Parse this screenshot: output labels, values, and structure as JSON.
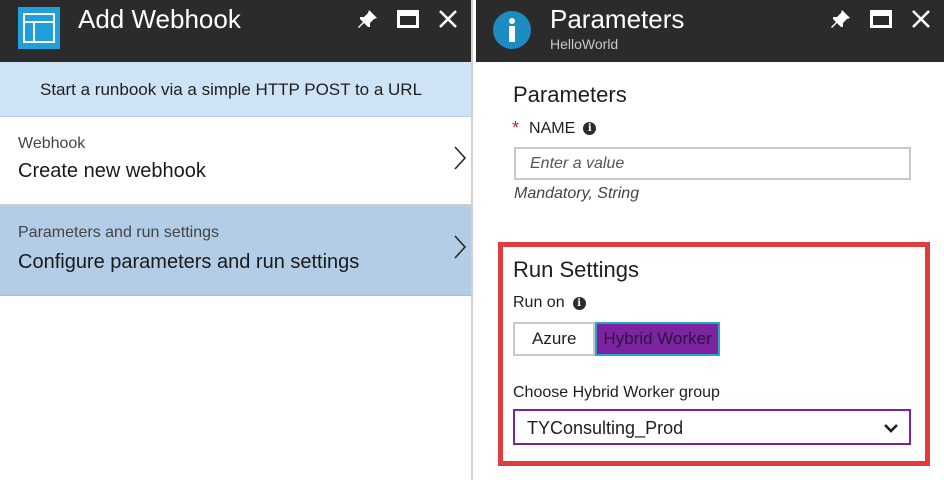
{
  "left_blade": {
    "title": "Add Webhook",
    "icon": "blade-layout-icon",
    "info_text": "Start a runbook via a simple HTTP POST to a URL",
    "items": [
      {
        "sublabel": "Webhook",
        "label": "Create new webhook"
      },
      {
        "sublabel": "Parameters and run settings",
        "label": "Configure parameters and run settings"
      }
    ]
  },
  "right_blade": {
    "title": "Parameters",
    "subtitle": "HelloWorld",
    "icon": "info-icon",
    "parameters": {
      "heading": "Parameters",
      "name_label": "NAME",
      "name_required": "*",
      "name_placeholder": "Enter a value",
      "name_hint": "Mandatory, String"
    },
    "run_settings": {
      "heading": "Run Settings",
      "run_on_label": "Run on",
      "options": [
        "Azure",
        "Hybrid Worker"
      ],
      "selected": "Hybrid Worker",
      "group_label": "Choose Hybrid Worker group",
      "group_value": "TYConsulting_Prod"
    }
  },
  "colors": {
    "title_bar": "#2b2b2b",
    "info_strip": "#cfe3f7",
    "selected_item": "#b2cde5",
    "highlight_border": "#e03b3f",
    "selected_toggle": "#7c249f",
    "info_icon": "#1e8bc3"
  }
}
